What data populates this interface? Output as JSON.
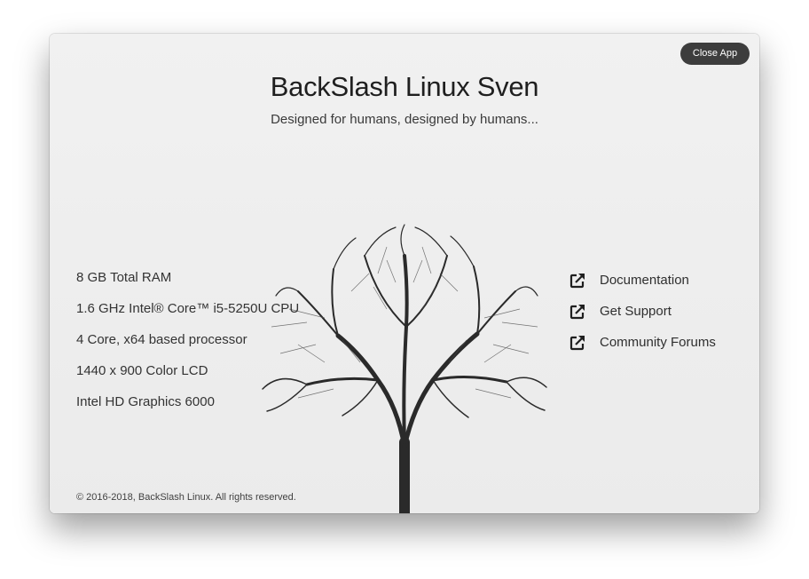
{
  "window": {
    "close_label": "Close App"
  },
  "header": {
    "title": "BackSlash Linux Sven",
    "subtitle": "Designed for humans, designed by humans..."
  },
  "specs": [
    "8 GB Total RAM",
    "1.6 GHz Intel® Core™ i5-5250U CPU",
    "4 Core, x64 based processor",
    "1440 x 900 Color LCD",
    "Intel HD Graphics 6000"
  ],
  "links": [
    {
      "label": "Documentation",
      "icon": "external-link-icon"
    },
    {
      "label": "Get Support",
      "icon": "external-link-icon"
    },
    {
      "label": "Community Forums",
      "icon": "external-link-icon"
    }
  ],
  "footer": {
    "copyright": "© 2016-2018, BackSlash Linux. All rights reserved."
  },
  "colors": {
    "background": "#eeeeee",
    "close_button": "#3d3d3d",
    "text": "#333333"
  }
}
